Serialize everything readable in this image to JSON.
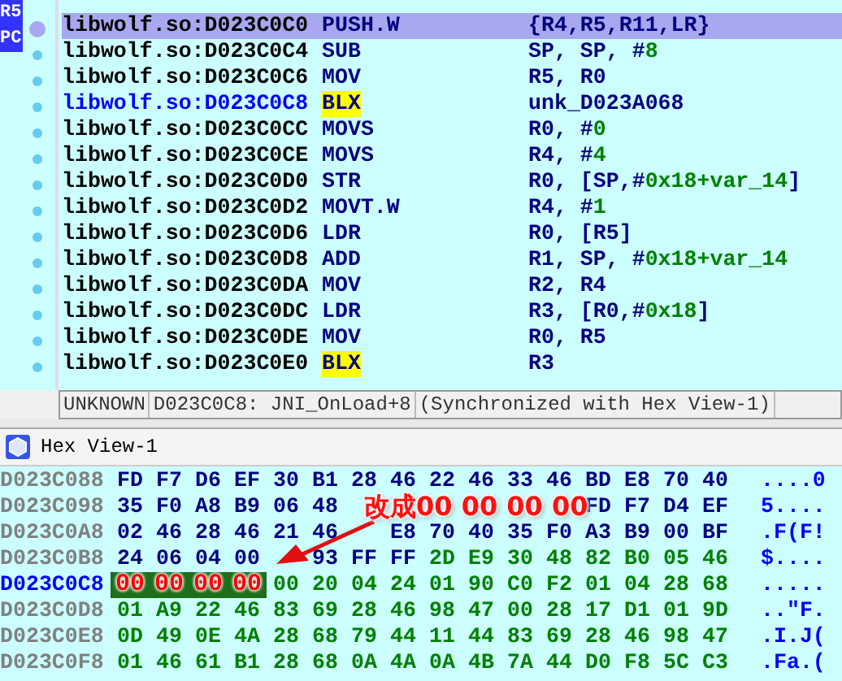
{
  "disassembly": {
    "registers": [
      {
        "label": "R5"
      },
      {
        "label": "PC"
      }
    ],
    "lines": [
      {
        "address": "libwolf.so:D023C0C0",
        "mnemonic": "PUSH.W",
        "marked": false,
        "selected": true,
        "current": false,
        "operands": [
          {
            "text": "{R4,R5,R11,LR}",
            "kind": "reg"
          }
        ]
      },
      {
        "address": "libwolf.so:D023C0C4",
        "mnemonic": "SUB",
        "marked": false,
        "selected": false,
        "current": false,
        "operands": [
          {
            "text": "SP, SP, #",
            "kind": "reg"
          },
          {
            "text": "8",
            "kind": "num"
          }
        ]
      },
      {
        "address": "libwolf.so:D023C0C6",
        "mnemonic": "MOV",
        "marked": false,
        "selected": false,
        "current": false,
        "operands": [
          {
            "text": "R5, R0",
            "kind": "reg"
          }
        ]
      },
      {
        "address": "libwolf.so:D023C0C8",
        "mnemonic": "BLX",
        "marked": true,
        "selected": false,
        "current": true,
        "operands": [
          {
            "text": "unk_D023A068",
            "kind": "reg"
          }
        ]
      },
      {
        "address": "libwolf.so:D023C0CC",
        "mnemonic": "MOVS",
        "marked": false,
        "selected": false,
        "current": false,
        "operands": [
          {
            "text": "R0, #",
            "kind": "reg"
          },
          {
            "text": "0",
            "kind": "num"
          }
        ]
      },
      {
        "address": "libwolf.so:D023C0CE",
        "mnemonic": "MOVS",
        "marked": false,
        "selected": false,
        "current": false,
        "operands": [
          {
            "text": "R4, #",
            "kind": "reg"
          },
          {
            "text": "4",
            "kind": "num"
          }
        ]
      },
      {
        "address": "libwolf.so:D023C0D0",
        "mnemonic": "STR",
        "marked": false,
        "selected": false,
        "current": false,
        "operands": [
          {
            "text": "R0, [SP,#",
            "kind": "reg"
          },
          {
            "text": "0x18+var_14",
            "kind": "num"
          },
          {
            "text": "]",
            "kind": "reg"
          }
        ]
      },
      {
        "address": "libwolf.so:D023C0D2",
        "mnemonic": "MOVT.W",
        "marked": false,
        "selected": false,
        "current": false,
        "operands": [
          {
            "text": "R4, #",
            "kind": "reg"
          },
          {
            "text": "1",
            "kind": "num"
          }
        ]
      },
      {
        "address": "libwolf.so:D023C0D6",
        "mnemonic": "LDR",
        "marked": false,
        "selected": false,
        "current": false,
        "operands": [
          {
            "text": "R0, [R5]",
            "kind": "reg"
          }
        ]
      },
      {
        "address": "libwolf.so:D023C0D8",
        "mnemonic": "ADD",
        "marked": false,
        "selected": false,
        "current": false,
        "operands": [
          {
            "text": "R1, SP, #",
            "kind": "reg"
          },
          {
            "text": "0x18+var_14",
            "kind": "num"
          }
        ]
      },
      {
        "address": "libwolf.so:D023C0DA",
        "mnemonic": "MOV",
        "marked": false,
        "selected": false,
        "current": false,
        "operands": [
          {
            "text": "R2, R4",
            "kind": "reg"
          }
        ]
      },
      {
        "address": "libwolf.so:D023C0DC",
        "mnemonic": "LDR",
        "marked": false,
        "selected": false,
        "current": false,
        "operands": [
          {
            "text": "R3, [R0,#",
            "kind": "reg"
          },
          {
            "text": "0x18",
            "kind": "num"
          },
          {
            "text": "]",
            "kind": "reg"
          }
        ]
      },
      {
        "address": "libwolf.so:D023C0DE",
        "mnemonic": "MOV",
        "marked": false,
        "selected": false,
        "current": false,
        "operands": [
          {
            "text": "R0, R5",
            "kind": "reg"
          }
        ]
      },
      {
        "address": "libwolf.so:D023C0E0",
        "mnemonic": "BLX",
        "marked": true,
        "selected": false,
        "current": false,
        "operands": [
          {
            "text": "R3",
            "kind": "reg"
          }
        ]
      }
    ]
  },
  "status_bar": [
    "UNKNOWN",
    "D023C0C8: JNI_OnLoad+8",
    "(Synchronized with Hex View-1)"
  ],
  "hex_view": {
    "title": "Hex View-1",
    "rows": [
      {
        "address": "D023C088",
        "current": false,
        "ascii": "....0",
        "bytes": [
          {
            "text": "FD",
            "kind": "data"
          },
          {
            "text": "F7",
            "kind": "data"
          },
          {
            "text": "D6",
            "kind": "data"
          },
          {
            "text": "EF",
            "kind": "data"
          },
          {
            "text": "30",
            "kind": "data"
          },
          {
            "text": "B1",
            "kind": "data"
          },
          {
            "text": "28",
            "kind": "data"
          },
          {
            "text": "46",
            "kind": "data"
          },
          {
            "text": "22",
            "kind": "data"
          },
          {
            "text": "46",
            "kind": "data"
          },
          {
            "text": "33",
            "kind": "data"
          },
          {
            "text": "46",
            "kind": "data"
          },
          {
            "text": "BD",
            "kind": "data"
          },
          {
            "text": "E8",
            "kind": "data"
          },
          {
            "text": "70",
            "kind": "data"
          },
          {
            "text": "40",
            "kind": "data"
          }
        ]
      },
      {
        "address": "D023C098",
        "current": false,
        "ascii": "5....",
        "bytes": [
          {
            "text": "35",
            "kind": "data"
          },
          {
            "text": "F0",
            "kind": "data"
          },
          {
            "text": "A8",
            "kind": "data"
          },
          {
            "text": "B9",
            "kind": "data"
          },
          {
            "text": "06",
            "kind": "data"
          },
          {
            "text": "48",
            "kind": "data"
          },
          {
            "kind": "covered"
          },
          {
            "kind": "covered"
          },
          {
            "kind": "covered"
          },
          {
            "kind": "covered"
          },
          {
            "kind": "covered"
          },
          {
            "kind": "covered"
          },
          {
            "text": "FD",
            "kind": "data"
          },
          {
            "text": "F7",
            "kind": "data"
          },
          {
            "text": "D4",
            "kind": "data"
          },
          {
            "text": "EF",
            "kind": "data"
          }
        ]
      },
      {
        "address": "D023C0A8",
        "current": false,
        "ascii": ".F(F!",
        "bytes": [
          {
            "text": "02",
            "kind": "data"
          },
          {
            "text": "46",
            "kind": "data"
          },
          {
            "text": "28",
            "kind": "data"
          },
          {
            "text": "46",
            "kind": "data"
          },
          {
            "text": "21",
            "kind": "data"
          },
          {
            "text": "46",
            "kind": "data"
          },
          {
            "kind": "covered"
          },
          {
            "text": "E8",
            "kind": "data"
          },
          {
            "text": "70",
            "kind": "data"
          },
          {
            "text": "40",
            "kind": "data"
          },
          {
            "text": "35",
            "kind": "data"
          },
          {
            "text": "F0",
            "kind": "data"
          },
          {
            "text": "A3",
            "kind": "data"
          },
          {
            "text": "B9",
            "kind": "data"
          },
          {
            "text": "00",
            "kind": "data"
          },
          {
            "text": "BF",
            "kind": "data"
          }
        ]
      },
      {
        "address": "D023C0B8",
        "current": false,
        "ascii": "$....",
        "bytes": [
          {
            "text": "24",
            "kind": "data"
          },
          {
            "text": "06",
            "kind": "data"
          },
          {
            "text": "04",
            "kind": "data"
          },
          {
            "text": "00",
            "kind": "data"
          },
          {
            "kind": "covered"
          },
          {
            "text": "93",
            "kind": "data"
          },
          {
            "text": "FF",
            "kind": "data"
          },
          {
            "text": "FF",
            "kind": "data"
          },
          {
            "text": "2D",
            "kind": "code"
          },
          {
            "text": "E9",
            "kind": "code"
          },
          {
            "text": "30",
            "kind": "code"
          },
          {
            "text": "48",
            "kind": "code"
          },
          {
            "text": "82",
            "kind": "code"
          },
          {
            "text": "B0",
            "kind": "code"
          },
          {
            "text": "05",
            "kind": "code"
          },
          {
            "text": "46",
            "kind": "code"
          }
        ]
      },
      {
        "address": "D023C0C8",
        "current": true,
        "ascii": ".....",
        "bytes": [
          {
            "text": "00",
            "kind": "patched"
          },
          {
            "text": "00",
            "kind": "patched"
          },
          {
            "text": "00",
            "kind": "patched"
          },
          {
            "text": "00",
            "kind": "patched"
          },
          {
            "text": "00",
            "kind": "code"
          },
          {
            "text": "20",
            "kind": "code"
          },
          {
            "text": "04",
            "kind": "code"
          },
          {
            "text": "24",
            "kind": "code"
          },
          {
            "text": "01",
            "kind": "code"
          },
          {
            "text": "90",
            "kind": "code"
          },
          {
            "text": "C0",
            "kind": "code"
          },
          {
            "text": "F2",
            "kind": "code"
          },
          {
            "text": "01",
            "kind": "code"
          },
          {
            "text": "04",
            "kind": "code"
          },
          {
            "text": "28",
            "kind": "code"
          },
          {
            "text": "68",
            "kind": "code"
          }
        ]
      },
      {
        "address": "D023C0D8",
        "current": false,
        "ascii": "..\"F.",
        "bytes": [
          {
            "text": "01",
            "kind": "code"
          },
          {
            "text": "A9",
            "kind": "code"
          },
          {
            "text": "22",
            "kind": "code"
          },
          {
            "text": "46",
            "kind": "code"
          },
          {
            "text": "83",
            "kind": "code"
          },
          {
            "text": "69",
            "kind": "code"
          },
          {
            "text": "28",
            "kind": "code"
          },
          {
            "text": "46",
            "kind": "code"
          },
          {
            "text": "98",
            "kind": "code"
          },
          {
            "text": "47",
            "kind": "code"
          },
          {
            "text": "00",
            "kind": "code"
          },
          {
            "text": "28",
            "kind": "code"
          },
          {
            "text": "17",
            "kind": "code"
          },
          {
            "text": "D1",
            "kind": "code"
          },
          {
            "text": "01",
            "kind": "code"
          },
          {
            "text": "9D",
            "kind": "code"
          }
        ]
      },
      {
        "address": "D023C0E8",
        "current": false,
        "ascii": ".I.J(",
        "bytes": [
          {
            "text": "0D",
            "kind": "code"
          },
          {
            "text": "49",
            "kind": "code"
          },
          {
            "text": "0E",
            "kind": "code"
          },
          {
            "text": "4A",
            "kind": "code"
          },
          {
            "text": "28",
            "kind": "code"
          },
          {
            "text": "68",
            "kind": "code"
          },
          {
            "text": "79",
            "kind": "code"
          },
          {
            "text": "44",
            "kind": "code"
          },
          {
            "text": "11",
            "kind": "code"
          },
          {
            "text": "44",
            "kind": "code"
          },
          {
            "text": "83",
            "kind": "code"
          },
          {
            "text": "69",
            "kind": "code"
          },
          {
            "text": "28",
            "kind": "code"
          },
          {
            "text": "46",
            "kind": "code"
          },
          {
            "text": "98",
            "kind": "code"
          },
          {
            "text": "47",
            "kind": "code"
          }
        ]
      },
      {
        "address": "D023C0F8",
        "current": false,
        "ascii": ".Fa.(",
        "bytes": [
          {
            "text": "01",
            "kind": "code"
          },
          {
            "text": "46",
            "kind": "code"
          },
          {
            "text": "61",
            "kind": "code"
          },
          {
            "text": "B1",
            "kind": "code"
          },
          {
            "text": "28",
            "kind": "code"
          },
          {
            "text": "68",
            "kind": "code"
          },
          {
            "text": "0A",
            "kind": "code"
          },
          {
            "text": "4A",
            "kind": "code"
          },
          {
            "text": "0A",
            "kind": "code"
          },
          {
            "text": "4B",
            "kind": "code"
          },
          {
            "text": "7A",
            "kind": "code"
          },
          {
            "text": "44",
            "kind": "code"
          },
          {
            "text": "D0",
            "kind": "code"
          },
          {
            "text": "F8",
            "kind": "code"
          },
          {
            "text": "5C",
            "kind": "code"
          },
          {
            "text": "C3",
            "kind": "code"
          }
        ]
      }
    ]
  },
  "annotation": {
    "text": "改成00 00 00 00"
  }
}
